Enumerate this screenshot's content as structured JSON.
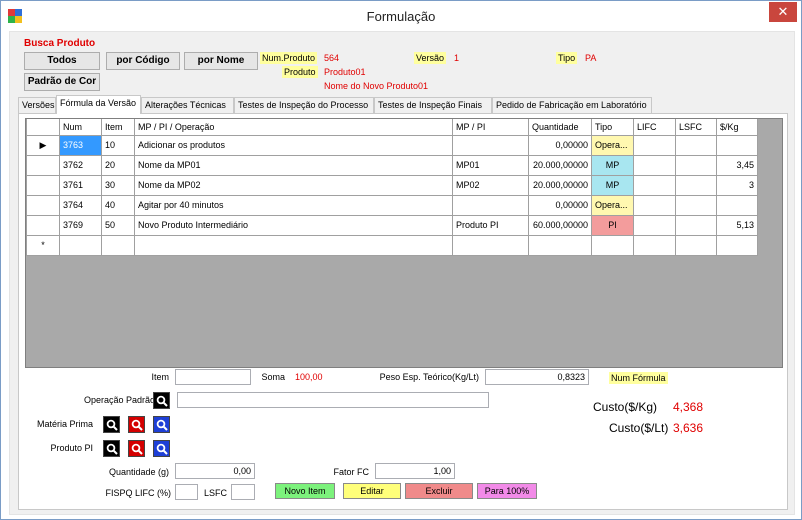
{
  "window": {
    "title": "Formulação",
    "close_glyph": "✕",
    "app_icon": "app-icon"
  },
  "busca": {
    "title": "Busca Produto",
    "btn_todos": "Todos",
    "btn_codigo": "por Código",
    "btn_nome": "por Nome",
    "btn_padrao_cor": "Padrão de Cor"
  },
  "produto": {
    "num_label": "Num.Produto",
    "num_value": "564",
    "versao_label": "Versão",
    "versao_value": "1",
    "tipo_label": "Tipo",
    "tipo_value": "PA",
    "produto_label": "Produto",
    "produto_value": "Produto01",
    "nome_value": "Nome do Novo Produto01"
  },
  "tabs": [
    {
      "label": "Versões"
    },
    {
      "label": "Fórmula da Versão"
    },
    {
      "label": "Alterações Técnicas"
    },
    {
      "label": "Testes de Inspeção do Processo"
    },
    {
      "label": "Testes de Inspeção Finais"
    },
    {
      "label": "Pedido de Fabricação em Laboratório"
    }
  ],
  "grid": {
    "columns": [
      "Num",
      "Item",
      "MP / PI / Operação",
      "MP / PI",
      "Quantidade",
      "Tipo",
      "LIFC",
      "LSFC",
      "$/Kg"
    ],
    "rows": [
      {
        "num": "3763",
        "item": "10",
        "desc": "Adicionar os produtos",
        "mppi": "",
        "qtd": "0,00000",
        "tipo": "Opera...",
        "lifc": "",
        "lsfc": "",
        "kg": ""
      },
      {
        "num": "3762",
        "item": "20",
        "desc": "Nome da MP01",
        "mppi": "MP01",
        "qtd": "20.000,00000",
        "tipo": "MP",
        "lifc": "",
        "lsfc": "",
        "kg": "3,45"
      },
      {
        "num": "3761",
        "item": "30",
        "desc": "Nome da MP02",
        "mppi": "MP02",
        "qtd": "20.000,00000",
        "tipo": "MP",
        "lifc": "",
        "lsfc": "",
        "kg": "3"
      },
      {
        "num": "3764",
        "item": "40",
        "desc": "Agitar por 40 minutos",
        "mppi": "",
        "qtd": "0,00000",
        "tipo": "Opera...",
        "lifc": "",
        "lsfc": "",
        "kg": ""
      },
      {
        "num": "3769",
        "item": "50",
        "desc": "Novo Produto Intermediário",
        "mppi": "Produto PI",
        "qtd": "60.000,00000",
        "tipo": "PI",
        "lifc": "",
        "lsfc": "",
        "kg": "5,13"
      }
    ],
    "new_row_marker": "*",
    "current_row_marker": "▶"
  },
  "form": {
    "item_label": "Item",
    "item_value": "",
    "soma_label": "Soma",
    "soma_value": "100,00",
    "peso_label": "Peso Esp. Teórico(Kg/Lt)",
    "peso_value": "0,8323",
    "num_formula_label": "Num Fórmula",
    "operacao_label": "Operação Padrão",
    "operacao_value": "",
    "materia_label": "Matéria Prima",
    "produto_pi_label": "Produto PI",
    "quantidade_label": "Quantidade (g)",
    "quantidade_value": "0,00",
    "fator_label": "Fator FC",
    "fator_value": "1,00",
    "fispq_label": "FISPQ LIFC (%)",
    "fispq_value": "",
    "lsfc_label": "LSFC",
    "lsfc_value": ""
  },
  "custos": {
    "kg_label": "Custo($/Kg)",
    "kg_value": "4,368",
    "lt_label": "Custo($/Lt)",
    "lt_value": "3,636"
  },
  "actions": {
    "novo": "Novo Item",
    "editar": "Editar",
    "excluir": "Excluir",
    "para100": "Para 100%"
  },
  "colors": {
    "accent_red": "#e00000",
    "label_yellow": "#ffff9e",
    "selection_blue": "#3399ff",
    "tipo_mp": "#a8e6f0",
    "tipo_pi": "#f39c9c",
    "tipo_operacao": "#fff8b0",
    "novo_green": "#7cf27c",
    "editar_yellow": "#ffff7a",
    "excluir_red": "#f08a8a",
    "para100_magenta": "#f28ae8"
  }
}
